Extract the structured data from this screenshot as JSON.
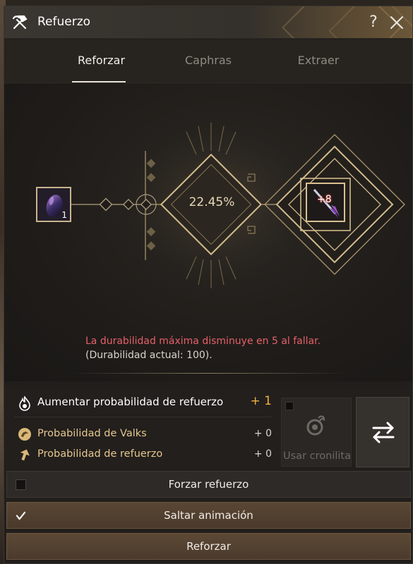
{
  "window": {
    "title": "Refuerzo",
    "help_label": "?"
  },
  "tabs": [
    {
      "label": "Reforzar",
      "active": true
    },
    {
      "label": "Caphras",
      "active": false
    },
    {
      "label": "Extraer",
      "active": false
    }
  ],
  "stage": {
    "material_count": "1",
    "success_chance": "22.45%",
    "item_level": "+8",
    "warning_line1": "La durabilidad máxima disminuye en 5 al fallar.",
    "warning_line2": "(Durabilidad actual: 100)."
  },
  "bonus": {
    "rows": [
      {
        "label": "Aumentar probabilidad de refuerzo",
        "value": "+ 1",
        "icon": "flame-icon"
      },
      {
        "label": "Probabilidad de Valks",
        "value": "+ 0",
        "icon": "valks-icon"
      },
      {
        "label": "Probabilidad de refuerzo",
        "value": "+ 0",
        "icon": "arrow-up-icon"
      }
    ],
    "cronstone_label": "Usar cronilita",
    "cronstone_checked": false
  },
  "buttons": {
    "force_label": "Forzar refuerzo",
    "force_checked": false,
    "skip_label": "Saltar animación",
    "skip_checked": true,
    "enhance_label": "Reforzar"
  },
  "colors": {
    "warning": "#e5606a",
    "bonus_accent": "#f0b040",
    "gold_label": "#e6c78f"
  }
}
